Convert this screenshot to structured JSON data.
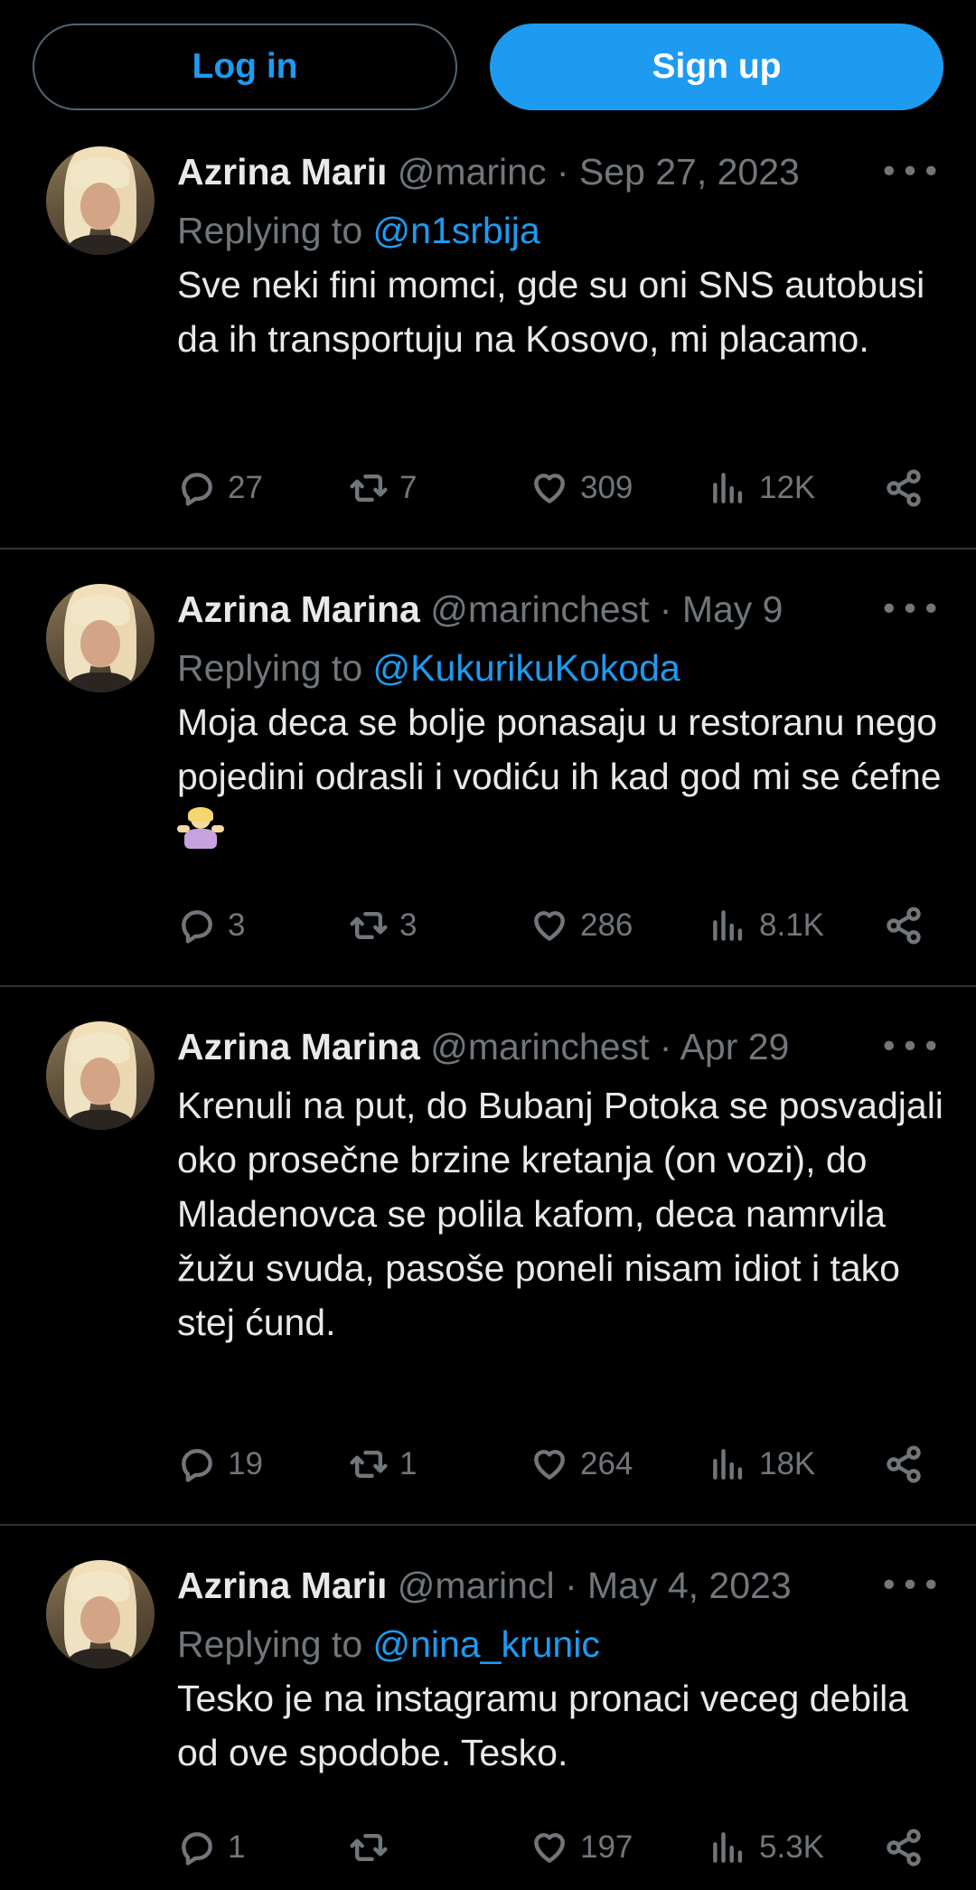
{
  "topbar": {
    "login_label": "Log in",
    "signup_label": "Sign up"
  },
  "colors": {
    "background": "#000000",
    "accent": "#1d9bf0",
    "text_primary": "#e7e9ea",
    "text_secondary": "#71767b",
    "divider": "#2f3336"
  },
  "tweets": [
    {
      "name": "Azrina Mariı",
      "meta": "@marinc · Sep 27, 2023",
      "replying_prefix": "Replying to ",
      "replying_handle": "@n1srbija",
      "text": "Sve neki fini momci, gde su oni SNS autobusi da ih transportuju na Kosovo, mi placamo.",
      "replies": "27",
      "retweets": "7",
      "likes": "309",
      "views": "12K"
    },
    {
      "name": "Azrina Marina",
      "meta": "@marinchest · May 9",
      "replying_prefix": "Replying to ",
      "replying_handle": "@KukurikuKokoda",
      "text": "Moja deca se bolje ponasaju u restoranu nego pojedini odrasli i vodiću ih kad god mi se ćefne",
      "emoji": "person-shrugging-emoji",
      "replies": "3",
      "retweets": "3",
      "likes": "286",
      "views": "8.1K"
    },
    {
      "name": "Azrina Marina",
      "meta": "@marinchest · Apr 29",
      "text": "Krenuli na put, do Bubanj Potoka se posvadjali oko prosečne brzine kretanja (on vozi), do Mladenovca se polila kafom, deca namrvila žužu svuda, pasoše poneli nisam idiot i tako stej ćund.",
      "replies": "19",
      "retweets": "1",
      "likes": "264",
      "views": "18K"
    },
    {
      "name": "Azrina Mariı",
      "meta": "@marincl · May 4, 2023",
      "replying_prefix": "Replying to ",
      "replying_handle": "@nina_krunic",
      "text": "Tesko je na instagramu pronaci veceg debila od ove spodobe. Tesko.",
      "replies": "1",
      "retweets": "",
      "likes": "197",
      "views": "5.3K"
    }
  ],
  "icons": {
    "reply": "reply-icon",
    "retweet": "retweet-icon",
    "like": "heart-icon",
    "views": "views-icon",
    "share": "share-icon",
    "more": "more-icon"
  }
}
